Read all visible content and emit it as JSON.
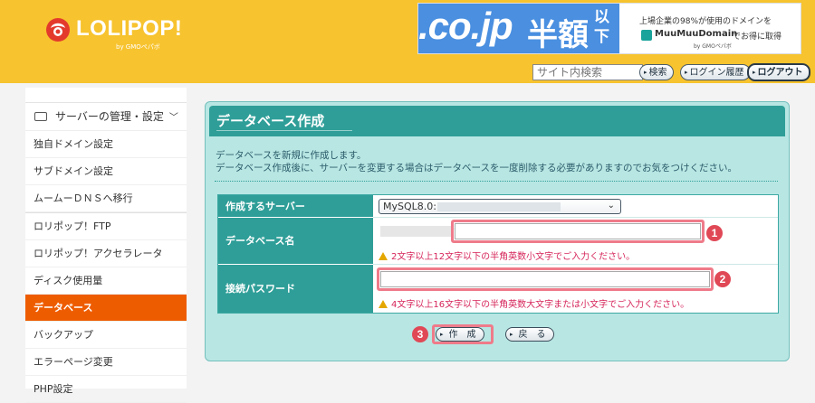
{
  "header": {
    "logo_text": "LOLIPOP!",
    "logo_sub": "by GMOペパボ",
    "banner": {
      "domain_text": ".co.jp",
      "half_price": "半額",
      "ika": "以下",
      "line1": "上場企業の98%が使用のドメインを",
      "brand": "MuuMuuDomain",
      "brand_tail": "でお得に取得",
      "brand_sub": "by GMOペパボ"
    },
    "search_placeholder": "サイト内検索",
    "search_button": "検索",
    "login_history_button": "ログイン履歴",
    "logout_button": "ログアウト"
  },
  "sidebar": {
    "group_label": "サーバーの管理・設定",
    "items_group1": [
      "独自ドメイン設定",
      "サブドメイン設定",
      "ムームーＤＮＳへ移行"
    ],
    "items_group2": [
      "ロリポップ！FTP",
      "ロリポップ！アクセラレータ",
      "ディスク使用量",
      "データベース",
      "バックアップ",
      "エラーページ変更",
      "PHP設定"
    ],
    "active_item": "データベース"
  },
  "panel": {
    "title": "データベース作成",
    "desc_line1": "データベースを新規に作成します。",
    "desc_line2": "データベース作成後に、サーバーを変更する場合はデータベースを一度削除する必要がありますのでお気をつけください。",
    "rows": {
      "server_label": "作成するサーバー",
      "server_value": "MySQL8.0:",
      "dbname_label": "データベース名",
      "dbname_hint": "2文字以上12文字以下の半角英数小文字でご入力ください。",
      "password_label": "接続パスワード",
      "password_hint": "4文字以上16文字以下の半角英数大文字または小文字でご入力ください。"
    },
    "create_button": "作　成",
    "back_button": "戻　る",
    "badges": [
      "1",
      "2",
      "3"
    ]
  },
  "colors": {
    "header_bg": "#f7c32e",
    "active_item_bg": "#ee5c00",
    "panel_bg": "#b8e6e3",
    "panel_head": "#2f9e98",
    "highlight": "#ef7b8a",
    "badge": "#e04856",
    "hint_text": "#d6255a"
  },
  "icons": [
    "lollipop-logo-icon",
    "muumuu-logo-icon",
    "server-icon",
    "chevron-down-icon",
    "warning-icon",
    "arrow-right-icon"
  ]
}
